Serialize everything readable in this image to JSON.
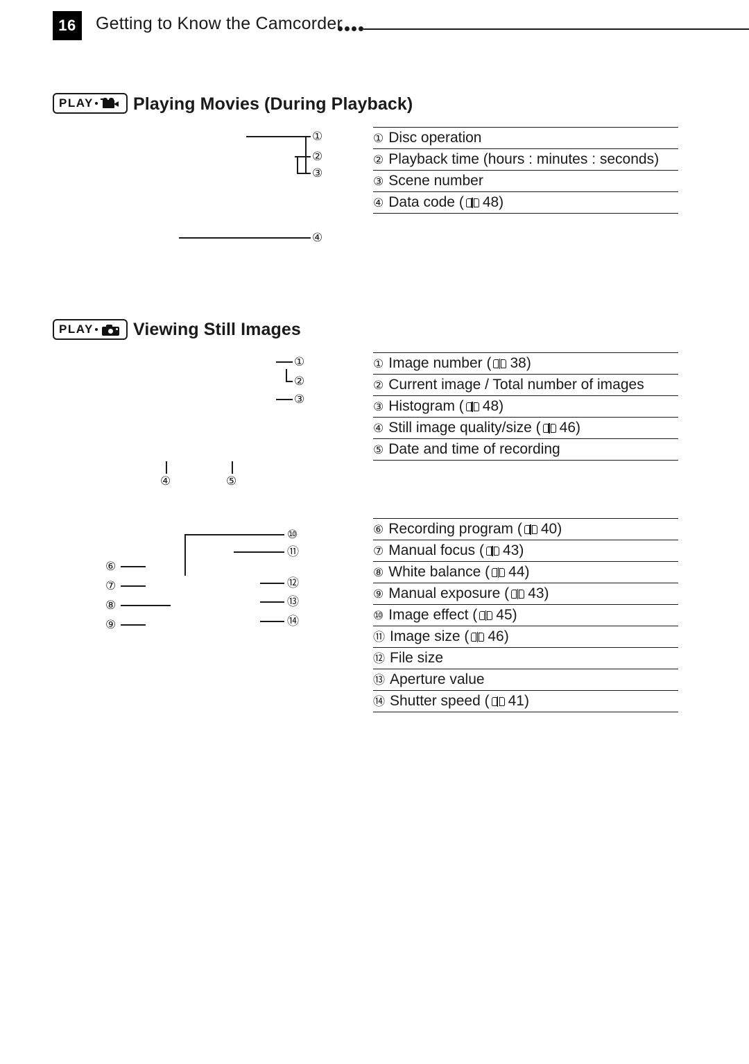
{
  "header": {
    "page_number": "16",
    "title": "Getting to Know the Camcorder",
    "dots_icon": "four-dots-icon"
  },
  "sections": [
    {
      "badge": {
        "label": "PLAY",
        "separator": "·",
        "icon": "movie-camera-icon"
      },
      "title": "Playing Movies (During Playback)",
      "legend": [
        {
          "num": "①",
          "text": "Disc operation"
        },
        {
          "num": "②",
          "text": "Playback time (hours : minutes : seconds)"
        },
        {
          "num": "③",
          "text": "Scene number"
        },
        {
          "num": "④",
          "text": "Data code (",
          "ref": "48",
          "suffix": ")"
        }
      ],
      "callouts": [
        "①",
        "②",
        "③",
        "④"
      ]
    },
    {
      "badge": {
        "label": "PLAY",
        "separator": "·",
        "icon": "still-camera-icon"
      },
      "title": "Viewing Still Images",
      "legend_top": [
        {
          "num": "①",
          "text": "Image number (",
          "ref": "38",
          "suffix": ")"
        },
        {
          "num": "②",
          "text": "Current image / Total number of images"
        },
        {
          "num": "③",
          "text": "Histogram (",
          "ref": "48",
          "suffix": ")"
        },
        {
          "num": "④",
          "text": "Still image quality/size (",
          "ref": "46",
          "suffix": ")"
        },
        {
          "num": "⑤",
          "text": "Date and time of recording"
        }
      ],
      "legend_bottom": [
        {
          "num": "⑥",
          "text": "Recording program (",
          "ref": "40",
          "suffix": ")"
        },
        {
          "num": "⑦",
          "text": "Manual focus (",
          "ref": "43",
          "suffix": ")"
        },
        {
          "num": "⑧",
          "text": "White balance (",
          "ref": "44",
          "suffix": ")"
        },
        {
          "num": "⑨",
          "text": "Manual exposure (",
          "ref": "43",
          "suffix": ")"
        },
        {
          "num": "⑩",
          "text": "Image effect (",
          "ref": "45",
          "suffix": ")"
        },
        {
          "num": "⑪",
          "text": "Image size (",
          "ref": "46",
          "suffix": ")"
        },
        {
          "num": "⑫",
          "text": "File size"
        },
        {
          "num": "⑬",
          "text": "Aperture value"
        },
        {
          "num": "⑭",
          "text": "Shutter speed (",
          "ref": "41",
          "suffix": ")"
        }
      ],
      "callouts_top": [
        "①",
        "②",
        "③",
        "④",
        "⑤"
      ],
      "callouts_bottom": [
        "⑥",
        "⑦",
        "⑧",
        "⑨",
        "⑩",
        "⑪",
        "⑫",
        "⑬",
        "⑭"
      ]
    }
  ]
}
